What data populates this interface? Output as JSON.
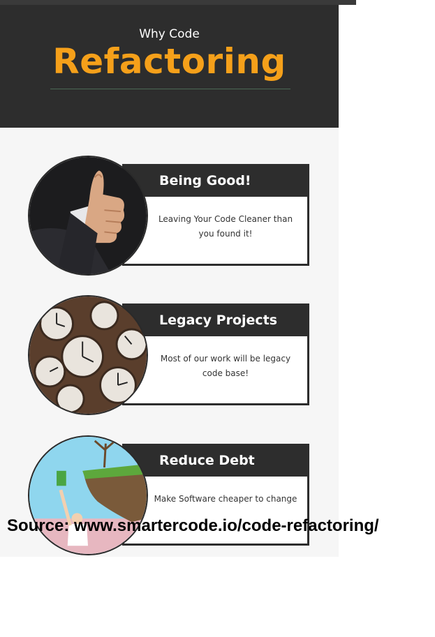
{
  "header": {
    "subtitle": "Why Code",
    "title": "Refactoring"
  },
  "cards": [
    {
      "title": "Being Good!",
      "description": "Leaving Your Code Cleaner than you found it!",
      "image_icon": "thumbs-up-photo"
    },
    {
      "title": "Legacy Projects",
      "description": "Most of our work will be legacy code base!",
      "image_icon": "clocks-photo"
    },
    {
      "title": "Reduce Debt",
      "description": "Make Software cheaper to change",
      "image_icon": "cliff-illustration"
    }
  ],
  "source": "Source: www.smartercode.io/code-refactoring/",
  "colors": {
    "header_bg": "#2d2d2d",
    "accent": "#f5a01a",
    "card_border": "#2d2d2d"
  }
}
